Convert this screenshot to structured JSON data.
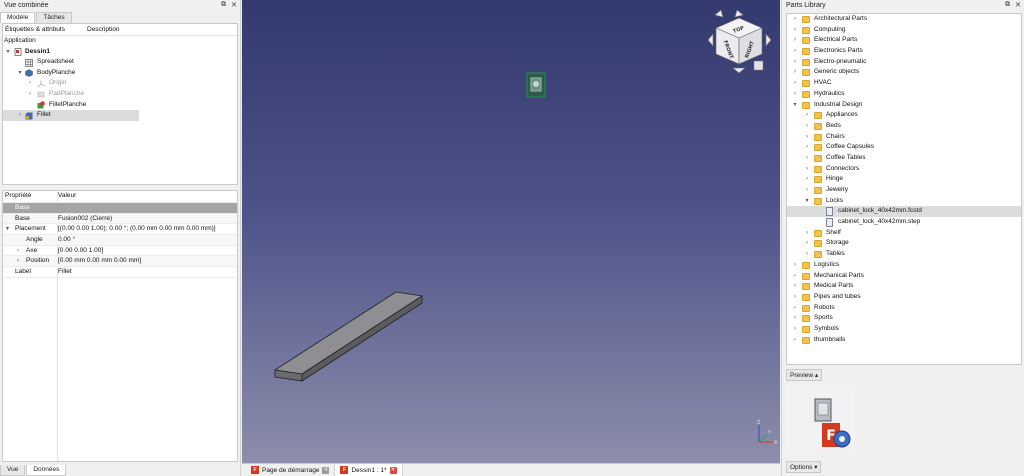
{
  "left_panel": {
    "title": "Vue combinée",
    "tabs": [
      "Modèle",
      "Tâches"
    ],
    "tree_headers": {
      "labels": "Étiquettes & attributs",
      "description": "Description"
    },
    "tree_root": "Application",
    "tree": {
      "doc": "Dessin1",
      "spreadsheet": "Spreadsheet",
      "body": "BodyPlanche",
      "origin": "Origin",
      "pad": "PadPlanche",
      "fillet_planche": "FilletPlanche",
      "fillet": "Fillet"
    },
    "prop_headers": {
      "property": "Propriété",
      "value": "Valeur"
    },
    "properties": {
      "group": "Base",
      "base_key": "Base",
      "base_val": "Fusion002 (Cierre)",
      "placement_key": "Placement",
      "placement_val": "[(0.00 0.00 1.00); 0.00 °; (0.00 mm  0.00 mm  0.00 mm)]",
      "angle_key": "Angle",
      "angle_val": "0.00 °",
      "axe_key": "Axe",
      "axe_val": "[0.00 0.00 1.00]",
      "position_key": "Position",
      "position_val": "[0.00 mm  0.00 mm  0.00 mm]",
      "label_key": "Label",
      "label_val": "Fillet"
    },
    "bottom_tabs": [
      "Vue",
      "Données"
    ]
  },
  "viewport": {
    "navcube_faces": [
      "RIGHT",
      "FRONT",
      "TOP"
    ],
    "axes": [
      "Z",
      "Y",
      "X"
    ]
  },
  "doc_tabs": [
    "Page de démarrage",
    "Dessin1 : 1*"
  ],
  "right_panel": {
    "title": "Parts Library",
    "items": [
      "Architectural Parts",
      "Computing",
      "Electrical Parts",
      "Electronics Parts",
      "Electro-pneumatic",
      "Generic objects",
      "HVAC",
      "Hydraulics",
      "Industrial Design"
    ],
    "industrial_children": [
      "Appliances",
      "Beds",
      "Chairs",
      "Coffee Capsules",
      "Coffee Tables",
      "Connectors",
      "Hinge",
      "Jewelry",
      "Locks"
    ],
    "lock_files": [
      "cabinet_lock_40x42mm.fcstd",
      "cabinet_lock_40x42mm.step"
    ],
    "industrial_after": [
      "Shelf",
      "Storage",
      "Tables"
    ],
    "items_after": [
      "Logistics",
      "Mechanical Parts",
      "Medical Parts",
      "Pipes and tubes",
      "Robots",
      "Sports",
      "Symbols",
      "thumbnails"
    ],
    "preview_label": "Preview ▴",
    "options_label": "Options ▾"
  },
  "colors": {
    "viewport_top": "#333a6e",
    "viewport_bottom": "#8c8eab",
    "folder": "#f3c44d",
    "freecad_red": "#d43b1e"
  }
}
